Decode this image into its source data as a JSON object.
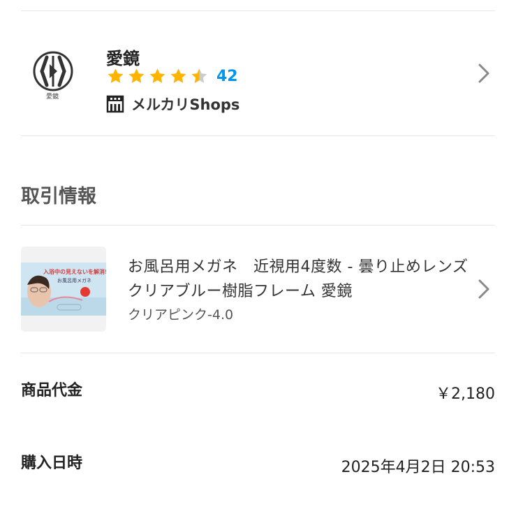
{
  "seller": {
    "name": "愛鏡",
    "logo_caption": "愛鏡",
    "rating": 4.5,
    "review_count": "42",
    "shops_label": "メルカリShops",
    "star_color": "#ffb400",
    "empty_star_color": "#cccccc",
    "count_color": "#0095ee"
  },
  "transaction": {
    "section_title": "取引情報",
    "product": {
      "title": "お風呂用メガネ　近視用4度数 - 曇り止めレンズクリアブルー樹脂フレーム  愛鏡",
      "variant": "クリアピンク-4.0",
      "thumb_caption_line1": "入浴中の見えないを解消!",
      "thumb_caption_line2": "お風呂用メガネ"
    },
    "price": {
      "label": "商品代金",
      "value": "￥2,180"
    },
    "purchase_date": {
      "label": "購入日時",
      "value": "2025年4月2日 20:53"
    }
  }
}
